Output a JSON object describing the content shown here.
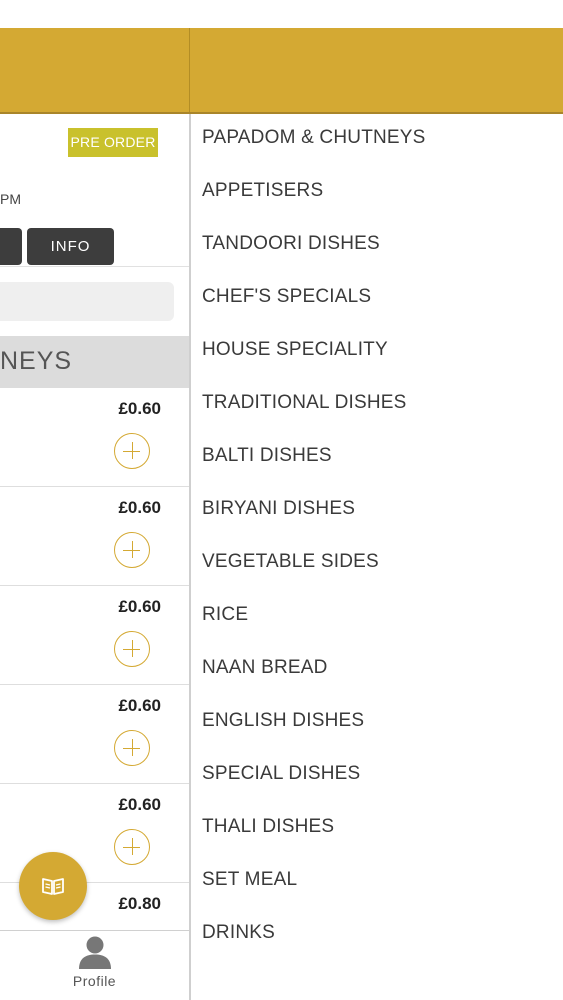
{
  "left_panel": {
    "pre_order_label": "PRE ORDER",
    "time_fragment": "PM",
    "info_button_label": "INFO",
    "category_header_fragment": "NEYS",
    "items": [
      {
        "price": "£0.60"
      },
      {
        "price": "£0.60"
      },
      {
        "price": "£0.60"
      },
      {
        "price": "£0.60"
      },
      {
        "price": "£0.60"
      },
      {
        "price": "£0.80"
      }
    ],
    "fab_icon": "menu-book-icon"
  },
  "bottom_nav": {
    "profile_label": "Profile",
    "profile_icon": "person-icon"
  },
  "drawer": {
    "categories": [
      "PAPADOM & CHUTNEYS",
      "APPETISERS",
      "TANDOORI DISHES",
      "CHEF'S SPECIALS",
      "HOUSE SPECIALITY",
      "TRADITIONAL DISHES",
      "BALTI DISHES",
      "BIRYANI DISHES",
      "VEGETABLE SIDES",
      "RICE",
      "NAAN BREAD",
      "ENGLISH DISHES",
      "SPECIAL DISHES",
      "THALI DISHES",
      "SET MEAL",
      "DRINKS"
    ]
  },
  "colors": {
    "accent": "#d4a933",
    "pre_order_badge": "#c9c12c",
    "dark_button": "#3d3d3d"
  }
}
